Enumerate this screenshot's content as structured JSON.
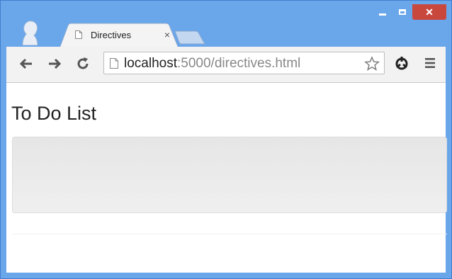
{
  "browser": {
    "tab": {
      "title": "Directives",
      "close_glyph": "×"
    },
    "window_controls": {
      "close_glyph": "✕"
    },
    "omnibox": {
      "host": "localhost",
      "rest": ":5000/directives.html"
    },
    "icons": [
      "profile-icon",
      "page-icon",
      "new-tab-icon",
      "back-icon",
      "forward-icon",
      "reload-icon",
      "star-icon",
      "extension-icon",
      "menu-icon",
      "minimize-icon",
      "maximize-icon",
      "close-icon"
    ]
  },
  "page": {
    "heading": "To Do List"
  },
  "colors": {
    "frame": "#6aa6ea",
    "close_button": "#c9483e",
    "toolbar": "#f2f2f2"
  }
}
